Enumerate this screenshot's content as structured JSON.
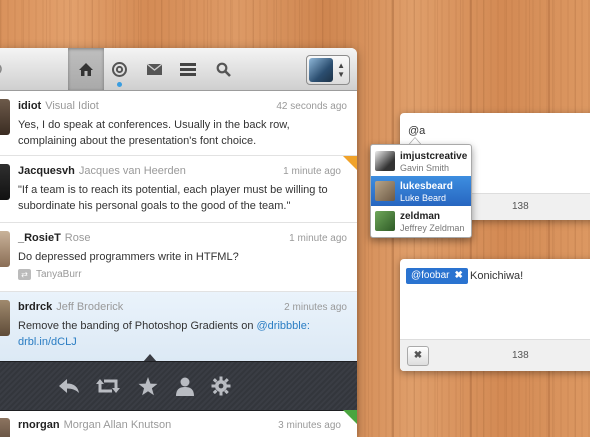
{
  "toolbar": {
    "tabs": [
      "home-tab",
      "mentions-tab",
      "messages-tab",
      "lists-tab",
      "search-tab"
    ],
    "active_tab": "home"
  },
  "timeline": [
    {
      "username": "idiot",
      "realname": "Visual Idiot",
      "time": "42 seconds ago",
      "text": "Yes, I do speak at conferences. Usually in the back row, complaining about the presentation's font choice."
    },
    {
      "username": "Jacquesvh",
      "realname": "Jacques van Heerden",
      "time": "1 minute ago",
      "text": "\"If a team is to reach its potential, each player must be willing to subordinate his personal goals to the good of the team.\""
    },
    {
      "username": "_RosieT",
      "realname": "Rose",
      "time": "1 minute ago",
      "text": "Do depressed programmers write in HTFML?",
      "retweeted_by": "TanyaBurr"
    },
    {
      "username": "brdrck",
      "realname": "Jeff Broderick",
      "time": "2 minutes ago",
      "text_prefix": "Remove the banding of Photoshop Gradients on ",
      "mention": "@dribbble",
      "text_sep": ": ",
      "link": "drbl.in/dCLJ"
    },
    {
      "username": "rnorgan",
      "realname": "Morgan Allan Knutson",
      "time": "3 minutes ago"
    }
  ],
  "actions": [
    "reply-icon",
    "retweet-icon",
    "favorite-icon",
    "profile-icon",
    "gear-icon"
  ],
  "composer1": {
    "input": "@a",
    "count": "138",
    "suggestions": [
      {
        "username": "imjustcreative",
        "name": "Gavin Smith"
      },
      {
        "username": "lukesbeard",
        "name": "Luke Beard",
        "highlighted": true
      },
      {
        "username": "zeldman",
        "name": "Jeffrey Zeldman"
      }
    ]
  },
  "composer2": {
    "token": "@foobar",
    "token_x": "✖",
    "text": "Konichiwa!",
    "cancel": "✖",
    "count": "138"
  },
  "colors": {
    "accent": "#2a73d0",
    "link": "#2a7dc3",
    "fav_orange": "#f0a22a",
    "fav_green": "#4aa53f"
  }
}
